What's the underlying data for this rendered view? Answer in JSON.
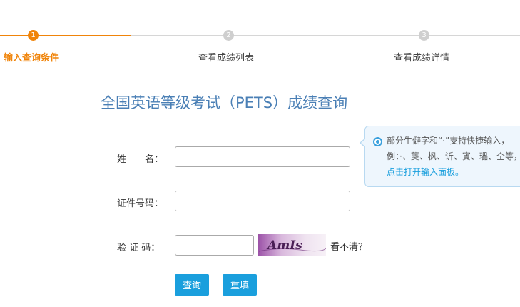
{
  "steps": [
    {
      "number": "1",
      "label": "输入查询条件"
    },
    {
      "number": "2",
      "label": "查看成绩列表"
    },
    {
      "number": "3",
      "label": "查看成绩详情"
    }
  ],
  "title": "全国英语等级考试（PETS）成绩查询",
  "form": {
    "name_label": "姓　　名：",
    "id_label": "证件号码：",
    "captcha_label": "验 证 码：",
    "name_value": "",
    "id_value": "",
    "captcha_value": "",
    "captcha_text": "AmIs",
    "refresh_label": "看不清？",
    "query_button": "查询",
    "reset_button": "重填"
  },
  "tip": {
    "text": "部分生僻字和“·”支持快捷输入，例：·、龑、枫、䜣、寊、瓃、仝等，",
    "link": "点击打开输入面板。"
  },
  "colors": {
    "accent": "#f0840a",
    "title": "#4a7fb5",
    "button": "#1a9fdd",
    "tip_bg": "#eef6fd"
  }
}
